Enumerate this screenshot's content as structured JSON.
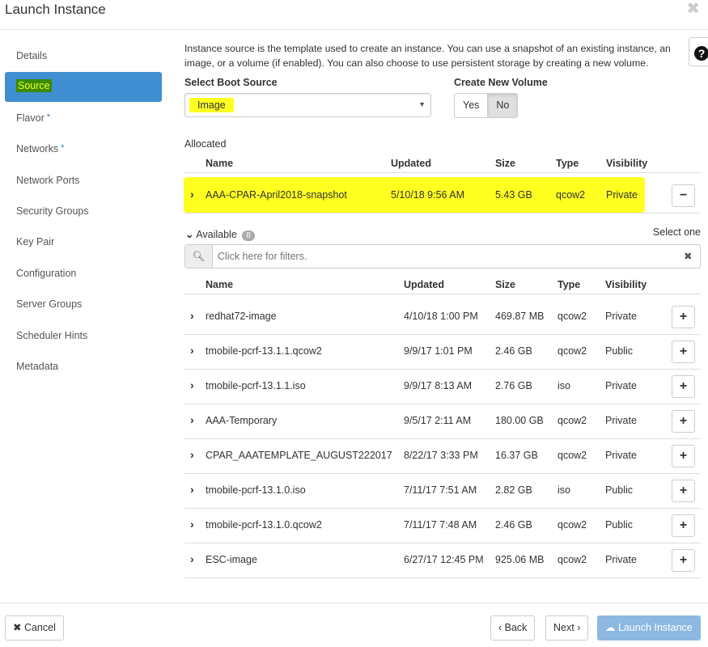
{
  "title": "Launch Instance",
  "sidebar": {
    "items": [
      {
        "label": "Details",
        "required": false
      },
      {
        "label": "Source",
        "required": false,
        "selected": true
      },
      {
        "label": "Flavor",
        "required": true
      },
      {
        "label": "Networks",
        "required": true
      },
      {
        "label": "Network Ports",
        "required": false
      },
      {
        "label": "Security Groups",
        "required": false
      },
      {
        "label": "Key Pair",
        "required": false
      },
      {
        "label": "Configuration",
        "required": false
      },
      {
        "label": "Server Groups",
        "required": false
      },
      {
        "label": "Scheduler Hints",
        "required": false
      },
      {
        "label": "Metadata",
        "required": false
      }
    ],
    "required_mark": "*"
  },
  "help_icon": "?",
  "intro": "Instance source is the template used to create an instance. You can use a snapshot of an existing instance, an image, or a volume (if enabled). You can also choose to use persistent storage by creating a new volume.",
  "boot_source": {
    "label": "Select Boot Source",
    "value": "Image"
  },
  "new_volume": {
    "label": "Create New Volume",
    "yes": "Yes",
    "no": "No",
    "selected": "No"
  },
  "allocated": {
    "label": "Allocated",
    "columns": [
      "Name",
      "Updated",
      "Size",
      "Type",
      "Visibility"
    ],
    "rows": [
      {
        "name": "AAA-CPAR-April2018-snapshot",
        "updated": "5/10/18 9:56 AM",
        "size": "5.43 GB",
        "type": "qcow2",
        "visibility": "Private"
      }
    ]
  },
  "available": {
    "label": "Available",
    "count": "8",
    "select_hint": "Select one",
    "filter_placeholder": "Click here for filters.",
    "columns": [
      "Name",
      "Updated",
      "Size",
      "Type",
      "Visibility"
    ],
    "rows": [
      {
        "name": "redhat72-image",
        "updated": "4/10/18 1:00 PM",
        "size": "469.87 MB",
        "type": "qcow2",
        "visibility": "Private"
      },
      {
        "name": "tmobile-pcrf-13.1.1.qcow2",
        "updated": "9/9/17 1:01 PM",
        "size": "2.46 GB",
        "type": "qcow2",
        "visibility": "Public"
      },
      {
        "name": "tmobile-pcrf-13.1.1.iso",
        "updated": "9/9/17 8:13 AM",
        "size": "2.76 GB",
        "type": "iso",
        "visibility": "Private"
      },
      {
        "name": "AAA-Temporary",
        "updated": "9/5/17 2:11 AM",
        "size": "180.00 GB",
        "type": "qcow2",
        "visibility": "Private"
      },
      {
        "name": "CPAR_AAATEMPLATE_AUGUST222017",
        "updated": "8/22/17 3:33 PM",
        "size": "16.37 GB",
        "type": "qcow2",
        "visibility": "Private"
      },
      {
        "name": "tmobile-pcrf-13.1.0.iso",
        "updated": "7/11/17 7:51 AM",
        "size": "2.82 GB",
        "type": "iso",
        "visibility": "Public"
      },
      {
        "name": "tmobile-pcrf-13.1.0.qcow2",
        "updated": "7/11/17 7:48 AM",
        "size": "2.46 GB",
        "type": "qcow2",
        "visibility": "Public"
      },
      {
        "name": "ESC-image",
        "updated": "6/27/17 12:45 PM",
        "size": "925.06 MB",
        "type": "qcow2",
        "visibility": "Private"
      }
    ]
  },
  "footer": {
    "cancel": "Cancel",
    "back": "Back",
    "next": "Next",
    "launch": "Launch Instance"
  },
  "colors": {
    "accent": "#3f8fd2",
    "highlight": "#ffff20",
    "launch": "#8db8e1"
  }
}
